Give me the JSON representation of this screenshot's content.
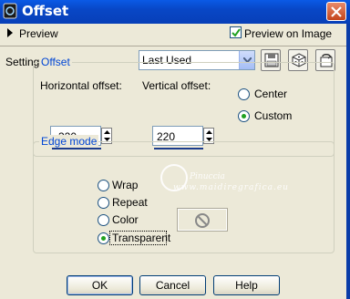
{
  "window": {
    "title": "Offset",
    "icon": "paint-shop-pro-icon",
    "close_icon": "close-icon"
  },
  "preview": {
    "toggle_label": "Preview",
    "preview_on_image_label": "Preview on Image",
    "preview_on_image_checked": true
  },
  "settings": {
    "label": "Settings",
    "selected": "Last Used",
    "tools": [
      "save-preset-icon",
      "randomize-icon",
      "reset-icon"
    ]
  },
  "offset": {
    "group_title": "Offset",
    "horizontal_label": "Horizontal offset:",
    "horizontal_value": "-320",
    "vertical_label": "Vertical offset:",
    "vertical_value": "220",
    "center_label": "Center",
    "custom_label": "Custom",
    "selected": "Custom"
  },
  "edge_mode": {
    "group_title": "Edge mode",
    "options": [
      "Wrap",
      "Repeat",
      "Color",
      "Transparent"
    ],
    "selected": "Transparent"
  },
  "watermark": {
    "name": "Pinuccia",
    "url": "www.maidiregrafica.eu"
  },
  "buttons": {
    "ok": "OK",
    "cancel": "Cancel",
    "help": "Help"
  },
  "colors": {
    "title_bar": "#0847c6",
    "dialog_bg": "#ece9d8",
    "group_title": "#0046d5",
    "radio_dot": "#21a121"
  }
}
